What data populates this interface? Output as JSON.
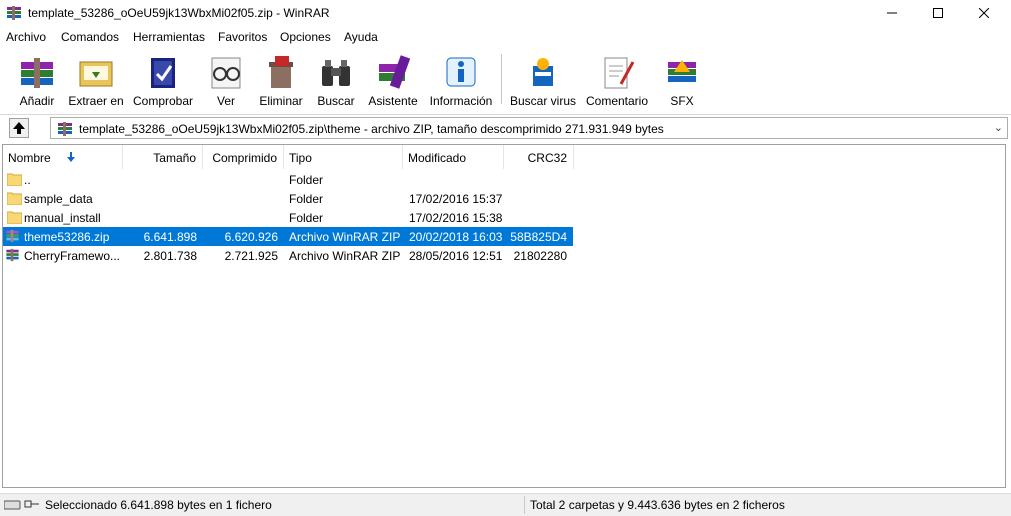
{
  "window": {
    "title": "template_53286_oOeU59jk13WbxMi02f05.zip - WinRAR"
  },
  "menu": [
    "Archivo",
    "Comandos",
    "Herramientas",
    "Favoritos",
    "Opciones",
    "Ayuda"
  ],
  "toolbar": {
    "buttons": [
      {
        "label": "Añadir",
        "icon": "books-add-icon"
      },
      {
        "label": "Extraer en",
        "icon": "extract-folder-icon"
      },
      {
        "label": "Comprobar",
        "icon": "test-archive-icon"
      },
      {
        "label": "Ver",
        "icon": "glasses-view-icon"
      },
      {
        "label": "Eliminar",
        "icon": "delete-icon"
      },
      {
        "label": "Buscar",
        "icon": "binoculars-icon"
      },
      {
        "label": "Asistente",
        "icon": "wizard-icon"
      },
      {
        "label": "Información",
        "icon": "info-icon"
      },
      {
        "label": "Buscar virus",
        "icon": "virus-scan-icon"
      },
      {
        "label": "Comentario",
        "icon": "comment-icon"
      },
      {
        "label": "SFX",
        "icon": "sfx-icon"
      }
    ]
  },
  "address": {
    "path": "template_53286_oOeU59jk13WbxMi02f05.zip\\theme - archivo ZIP, tamaño descomprimido 271.931.949 bytes"
  },
  "columns": [
    "Nombre",
    "Tamaño",
    "Comprimido",
    "Tipo",
    "Modificado",
    "CRC32"
  ],
  "files": [
    {
      "name": "..",
      "size": "",
      "packed": "",
      "type": "Folder",
      "modified": "",
      "crc": "",
      "kind": "folder"
    },
    {
      "name": "sample_data",
      "size": "",
      "packed": "",
      "type": "Folder",
      "modified": "17/02/2016 15:37",
      "crc": "",
      "kind": "folder"
    },
    {
      "name": "manual_install",
      "size": "",
      "packed": "",
      "type": "Folder",
      "modified": "17/02/2016 15:38",
      "crc": "",
      "kind": "folder"
    },
    {
      "name": "theme53286.zip",
      "size": "6.641.898",
      "packed": "6.620.926",
      "type": "Archivo WinRAR ZIP",
      "modified": "20/02/2018 16:03",
      "crc": "58B825D4",
      "kind": "zip"
    },
    {
      "name": "CherryFramewo...",
      "size": "2.801.738",
      "packed": "2.721.925",
      "type": "Archivo WinRAR ZIP",
      "modified": "28/05/2016 12:51",
      "crc": "21802280",
      "kind": "zip"
    }
  ],
  "status": {
    "left": "Seleccionado 6.641.898 bytes en 1 fichero",
    "right": "Total 2 carpetas y 9.443.636 bytes en 2 ficheros"
  },
  "colors": {
    "selection": "#0078d7",
    "folder": "#f8d775"
  }
}
